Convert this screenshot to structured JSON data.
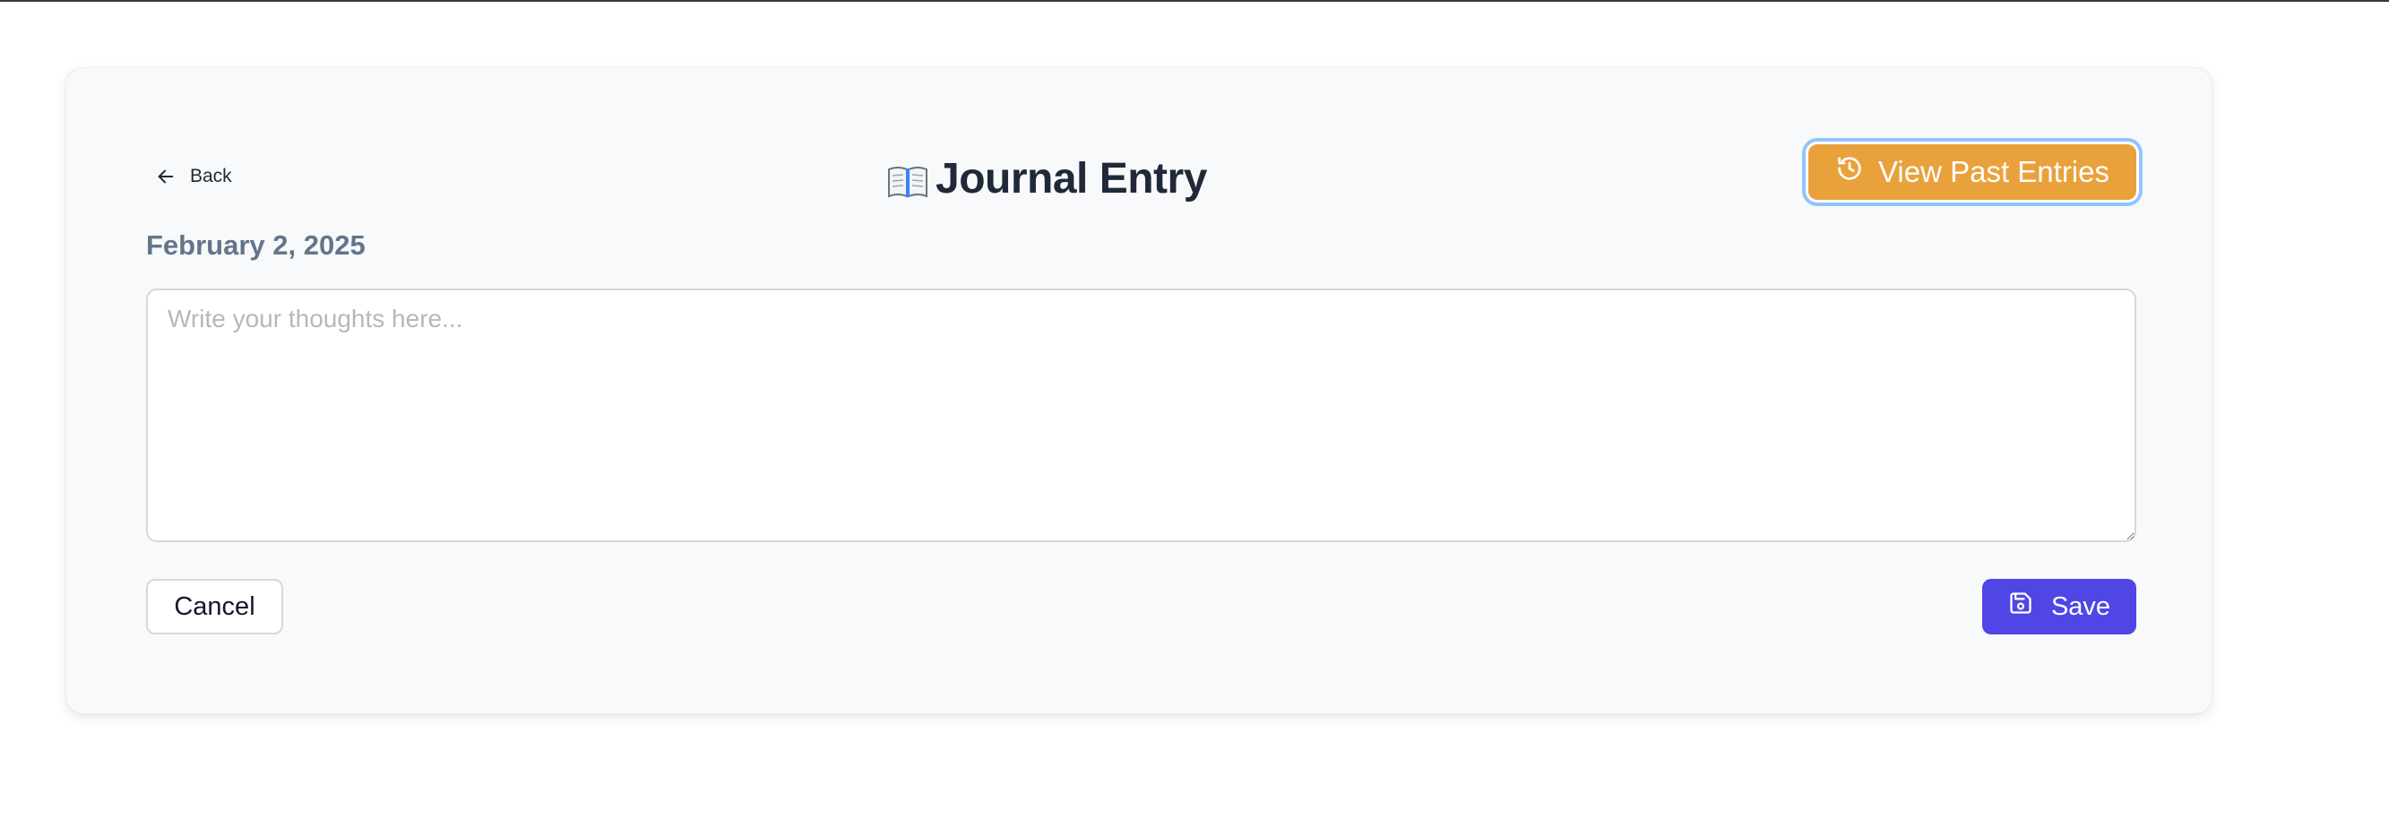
{
  "header": {
    "back_label": "Back",
    "title": "Journal Entry",
    "title_icon": "open-book-icon",
    "view_past_label": "View Past Entries",
    "view_past_icon": "history-clock-icon"
  },
  "entry": {
    "date": "February 2, 2025",
    "placeholder": "Write your thoughts here...",
    "value": ""
  },
  "actions": {
    "cancel_label": "Cancel",
    "save_label": "Save",
    "save_icon": "save-disk-icon"
  },
  "colors": {
    "accent_orange": "#e9a23b",
    "focus_ring": "#93c5fd",
    "primary": "#4f46e5",
    "date_text": "#64748b",
    "title_text": "#1f2937"
  }
}
